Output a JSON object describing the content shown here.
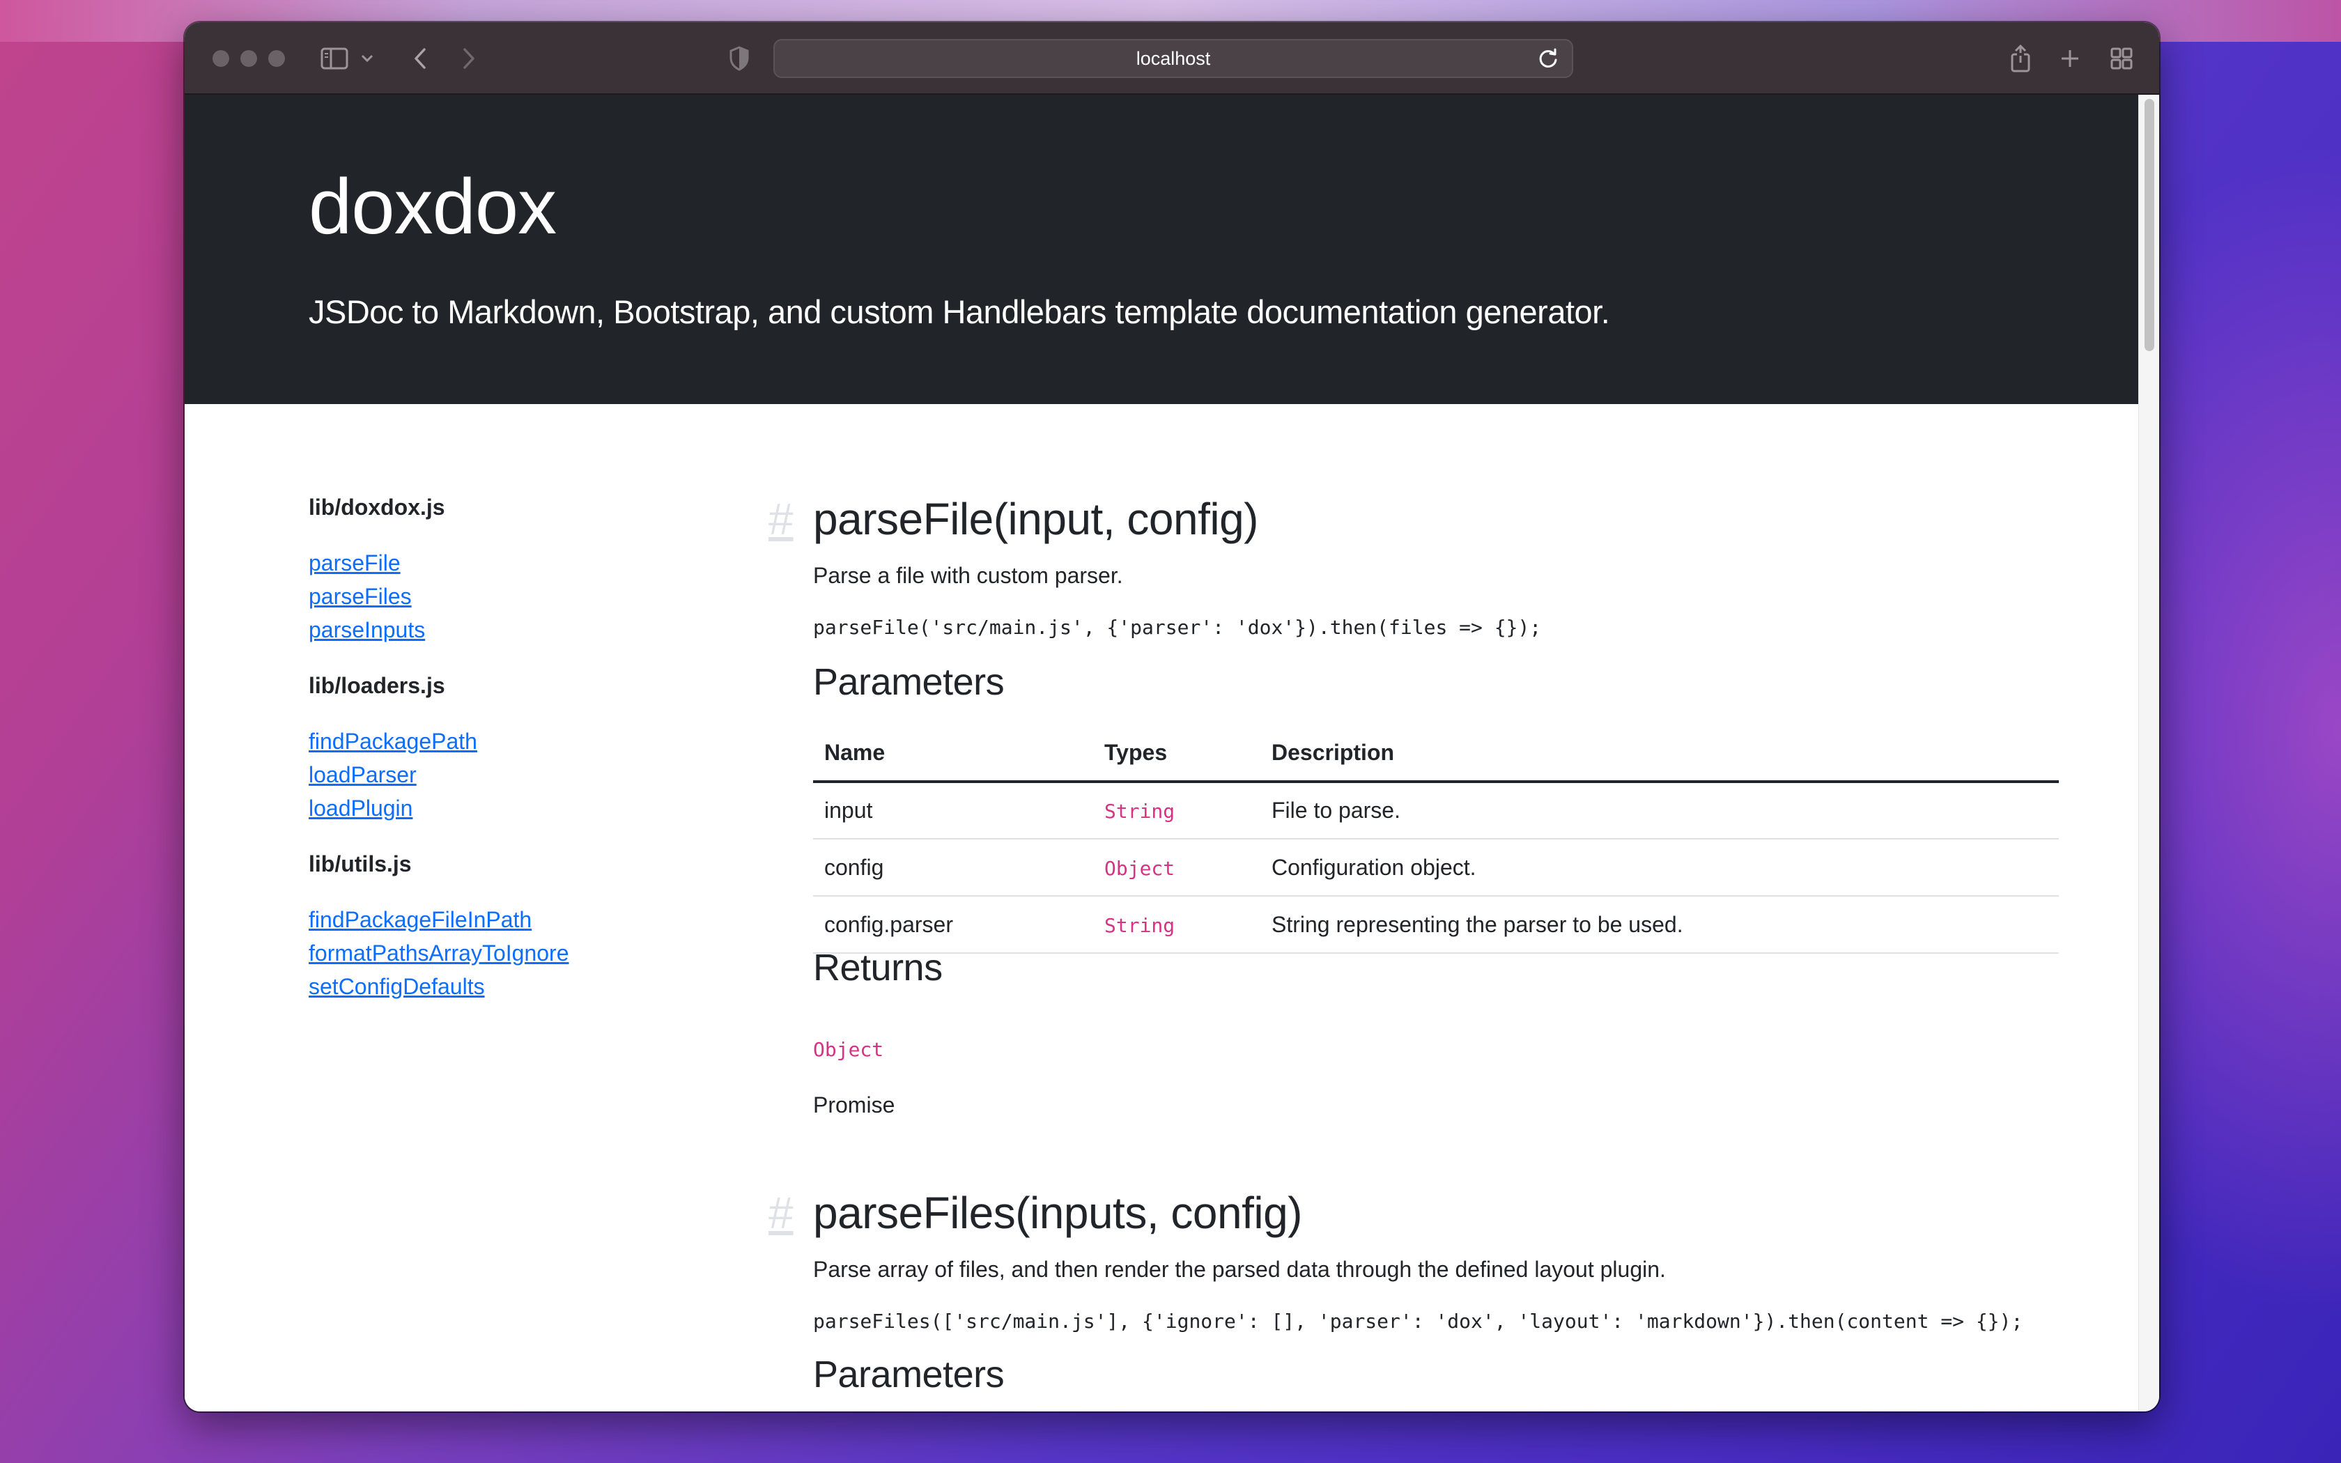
{
  "browser": {
    "url": "localhost"
  },
  "site": {
    "title": "doxdox",
    "subtitle": "JSDoc to Markdown, Bootstrap, and custom Handlebars template documentation generator."
  },
  "sidebar": {
    "groups": [
      {
        "title": "lib/doxdox.js",
        "links": [
          "parseFile",
          "parseFiles",
          "parseInputs"
        ]
      },
      {
        "title": "lib/loaders.js",
        "links": [
          "findPackagePath",
          "loadParser",
          "loadPlugin"
        ]
      },
      {
        "title": "lib/utils.js",
        "links": [
          "findPackageFileInPath",
          "formatPathsArrayToIgnore",
          "setConfigDefaults"
        ]
      }
    ]
  },
  "methods": [
    {
      "anchor": "#",
      "title": "parseFile(input, config)",
      "description": "Parse a file with custom parser.",
      "example": "parseFile('src/main.js', {'parser': 'dox'}).then(files => {});",
      "parameters_heading": "Parameters",
      "table_headers": [
        "Name",
        "Types",
        "Description"
      ],
      "parameters": [
        {
          "name": "input",
          "type": "String",
          "description": "File to parse."
        },
        {
          "name": "config",
          "type": "Object",
          "description": "Configuration object."
        },
        {
          "name": "config.parser",
          "type": "String",
          "description": "String representing the parser to be used."
        }
      ],
      "returns_heading": "Returns",
      "returns_type": "Object",
      "returns_description": "Promise"
    },
    {
      "anchor": "#",
      "title": "parseFiles(inputs, config)",
      "description": "Parse array of files, and then render the parsed data through the defined layout plugin.",
      "example": "parseFiles(['src/main.js'], {'ignore': [], 'parser': 'dox', 'layout': 'markdown'}).then(content => {});",
      "parameters_heading": "Parameters"
    }
  ]
}
